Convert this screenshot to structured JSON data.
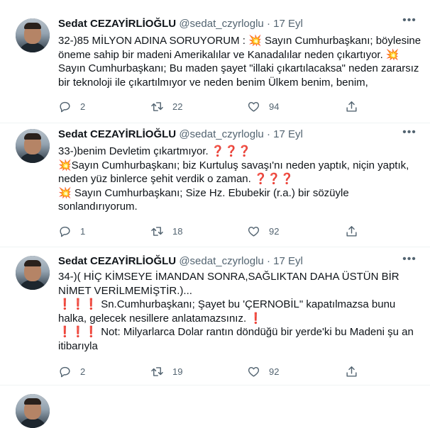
{
  "tweets": [
    {
      "author_name": "Sedat CEZAYİRLİOĞLU",
      "handle": "@sedat_czyrloglu",
      "date": "17 Eyl",
      "lines": [
        "32-)85 MİLYON ADINA SORUYORUM : 💥 Sayın Cumhurbaşkanı; böylesine",
        "öneme sahip bir madeni Amerikalılar ve Kanadalılar neden çıkartıyor. 💥",
        "Sayın Cumhurbaşkanı; Bu maden şayet \"illaki çıkartılacaksa\" neden zararsız",
        "bir teknoloji ile çıkartılmıyor ve neden benim Ülkem benim, benim,"
      ],
      "replies": "2",
      "retweets": "22",
      "likes": "94"
    },
    {
      "author_name": "Sedat CEZAYİRLİOĞLU",
      "handle": "@sedat_czyrloglu",
      "date": "17 Eyl",
      "lines": [
        "33-)benim Devletim çıkartmıyor. ❓❓❓",
        "💥Sayın Cumhurbaşkanı; biz Kurtuluş savaşı'nı neden yaptık, niçin yaptık,",
        "neden yüz binlerce şehit verdik o zaman. ❓❓❓",
        "💥 Sayın Cumhurbaşkanı; Size Hz. Ebubekir (r.a.) bir sözüyle",
        "sonlandırıyorum."
      ],
      "replies": "1",
      "retweets": "18",
      "likes": "92"
    },
    {
      "author_name": "Sedat CEZAYİRLİOĞLU",
      "handle": "@sedat_czyrloglu",
      "date": "17 Eyl",
      "lines": [
        "34-)( HİÇ KİMSEYE İMANDAN SONRA,SAĞLIKTAN DAHA ÜSTÜN BİR",
        "NİMET VERİLMEMİŞTİR.)...",
        "❗❗❗ Sn.Cumhurbaşkanı; Şayet bu 'ÇERNOBİL\" kapatılmazsa bunu",
        "halka, gelecek nesillere anlatamazsınız. ❗",
        "❗❗❗ Not: Milyarlarca Dolar rantın döndüğü bir yerde'ki bu Madeni şu an",
        "itibarıyla"
      ],
      "replies": "2",
      "retweets": "19",
      "likes": "92"
    }
  ],
  "icons": {
    "more": "more-horizontal-icon",
    "reply": "reply-bubble-icon",
    "retweet": "retweet-icon",
    "like": "heart-icon",
    "share": "share-icon"
  }
}
